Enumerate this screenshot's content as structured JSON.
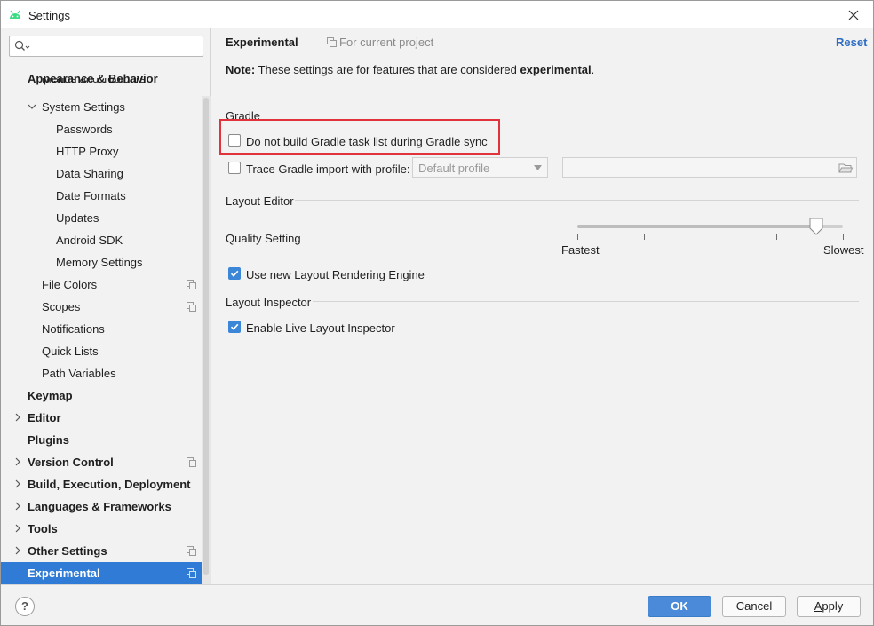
{
  "window": {
    "title": "Settings",
    "close_icon": "close-icon"
  },
  "search": {
    "value": "",
    "placeholder": ""
  },
  "sidebar": {
    "items": [
      {
        "label": "Appearance & Behavior",
        "level": 0,
        "bold": true
      },
      {
        "label": "Menus and Toolbars",
        "level": 1,
        "bold": false
      },
      {
        "label": "System Settings",
        "level": 1,
        "bold": false,
        "expanded": true
      },
      {
        "label": "Passwords",
        "level": 2,
        "bold": false
      },
      {
        "label": "HTTP Proxy",
        "level": 2,
        "bold": false
      },
      {
        "label": "Data Sharing",
        "level": 2,
        "bold": false
      },
      {
        "label": "Date Formats",
        "level": 2,
        "bold": false
      },
      {
        "label": "Updates",
        "level": 2,
        "bold": false
      },
      {
        "label": "Android SDK",
        "level": 2,
        "bold": false
      },
      {
        "label": "Memory Settings",
        "level": 2,
        "bold": false
      },
      {
        "label": "File Colors",
        "level": 1,
        "bold": false,
        "project": true
      },
      {
        "label": "Scopes",
        "level": 1,
        "bold": false,
        "project": true
      },
      {
        "label": "Notifications",
        "level": 1,
        "bold": false
      },
      {
        "label": "Quick Lists",
        "level": 1,
        "bold": false
      },
      {
        "label": "Path Variables",
        "level": 1,
        "bold": false
      },
      {
        "label": "Keymap",
        "level": 0,
        "bold": true
      },
      {
        "label": "Editor",
        "level": 0,
        "bold": true,
        "collapsed": true
      },
      {
        "label": "Plugins",
        "level": 0,
        "bold": true
      },
      {
        "label": "Version Control",
        "level": 0,
        "bold": true,
        "collapsed": true,
        "project": true
      },
      {
        "label": "Build, Execution, Deployment",
        "level": 0,
        "bold": true,
        "collapsed": true
      },
      {
        "label": "Languages & Frameworks",
        "level": 0,
        "bold": true,
        "collapsed": true
      },
      {
        "label": "Tools",
        "level": 0,
        "bold": true,
        "collapsed": true
      },
      {
        "label": "Other Settings",
        "level": 0,
        "bold": true,
        "collapsed": true,
        "project": true
      },
      {
        "label": "Experimental",
        "level": 0,
        "bold": true,
        "selected": true,
        "project": true
      }
    ]
  },
  "main": {
    "title": "Experimental",
    "scope": "For current project",
    "reset": "Reset",
    "note_prefix": "Note:",
    "note_text": " These settings are for features that are considered ",
    "note_bold": "experimental",
    "note_suffix": ".",
    "gradle": {
      "section": "Gradle",
      "no_task_list": {
        "label": "Do not build Gradle task list during Gradle sync",
        "checked": false
      },
      "trace_import": {
        "label": "Trace Gradle import with profile:",
        "checked": false
      },
      "profile_combo": "Default profile",
      "profile_path": ""
    },
    "layout_editor": {
      "section": "Layout Editor",
      "quality_label": "Quality Setting",
      "slider_min": "Fastest",
      "slider_max": "Slowest",
      "slider_steps": 5,
      "slider_value_fraction": 0.9,
      "new_rendering": {
        "label": "Use new Layout Rendering Engine",
        "checked": true
      }
    },
    "layout_inspector": {
      "section": "Layout Inspector",
      "live": {
        "label": "Enable Live Layout Inspector",
        "checked": true
      }
    }
  },
  "footer": {
    "help": "?",
    "ok": "OK",
    "cancel": "Cancel",
    "apply_prefix": "",
    "apply_underline": "A",
    "apply_rest": "pply"
  },
  "colors": {
    "accent": "#2f7bd6",
    "highlight": "#e0333c",
    "link": "#2f6ec2"
  }
}
